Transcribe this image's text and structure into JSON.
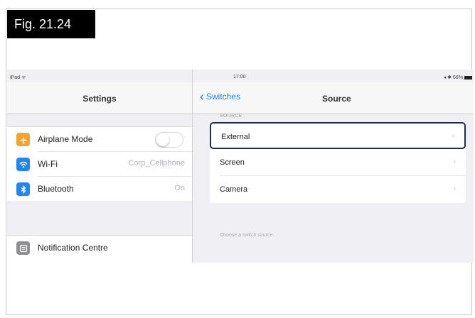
{
  "figure": {
    "label": "Fig. 21.24"
  },
  "status_bar": {
    "device": "iPad ᯤ",
    "time": "17:00",
    "battery": "◂ ✱ 66%"
  },
  "left_pane": {
    "title": "Settings",
    "items": [
      {
        "label": "Airplane Mode",
        "icon": "airplane-icon",
        "color": "#f7a22b",
        "value": "",
        "toggle": true
      },
      {
        "label": "Wi-Fi",
        "icon": "wifi-icon",
        "color": "#1f86f5",
        "value": "Corp_Cellphone"
      },
      {
        "label": "Bluetooth",
        "icon": "bluetooth-icon",
        "color": "#1f86f5",
        "value": "On"
      }
    ],
    "items2": [
      {
        "label": "Notification Centre",
        "icon": "notification-centre-icon",
        "color": "#8e8e93"
      }
    ]
  },
  "right_pane": {
    "back_label": "Switches",
    "title": "Source",
    "section_header": "SOURCE",
    "options": [
      {
        "label": "External",
        "selected": true
      },
      {
        "label": "Screen",
        "selected": false
      },
      {
        "label": "Camera",
        "selected": false
      }
    ],
    "footer": "Choose a switch source."
  }
}
